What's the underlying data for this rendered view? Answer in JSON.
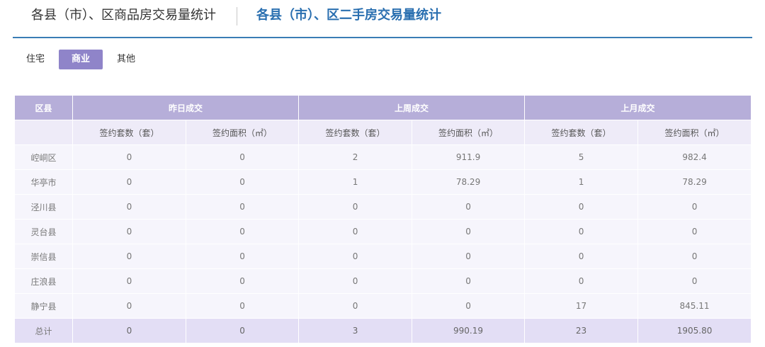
{
  "header": {
    "tab1": "各县（市）、区商品房交易量统计",
    "tab2": "各县（市）、区二手房交易量统计"
  },
  "type_tabs": [
    "住宅",
    "商业",
    "其他"
  ],
  "table": {
    "group_headers": [
      "区县",
      "昨日成交",
      "上周成交",
      "上月成交"
    ],
    "sub_headers": [
      "签约套数（套）",
      "签约面积（㎡）",
      "签约套数（套）",
      "签约面积（㎡）",
      "签约套数（套）",
      "签约面积（㎡）"
    ],
    "rows": [
      {
        "name": "崆峒区",
        "values": [
          "0",
          "0",
          "2",
          "911.9",
          "5",
          "982.4"
        ]
      },
      {
        "name": "华亭市",
        "values": [
          "0",
          "0",
          "1",
          "78.29",
          "1",
          "78.29"
        ]
      },
      {
        "name": "泾川县",
        "values": [
          "0",
          "0",
          "0",
          "0",
          "0",
          "0"
        ]
      },
      {
        "name": "灵台县",
        "values": [
          "0",
          "0",
          "0",
          "0",
          "0",
          "0"
        ]
      },
      {
        "name": "崇信县",
        "values": [
          "0",
          "0",
          "0",
          "0",
          "0",
          "0"
        ]
      },
      {
        "name": "庄浪县",
        "values": [
          "0",
          "0",
          "0",
          "0",
          "0",
          "0"
        ]
      },
      {
        "name": "静宁县",
        "values": [
          "0",
          "0",
          "0",
          "0",
          "17",
          "845.11"
        ]
      }
    ],
    "total": {
      "name": "总计",
      "values": [
        "0",
        "0",
        "3",
        "990.19",
        "23",
        "1905.80"
      ]
    }
  }
}
